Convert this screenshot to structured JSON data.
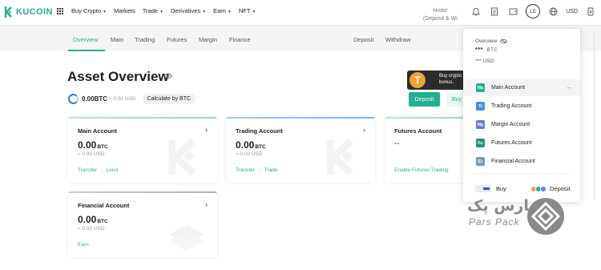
{
  "brand": {
    "name": "KUCOIN",
    "accent": "#23af91"
  },
  "topnav": {
    "items": [
      {
        "label": "Buy Crypto",
        "caret": true
      },
      {
        "label": "Markets",
        "caret": false
      },
      {
        "label": "Trade",
        "caret": true
      },
      {
        "label": "Derivatives",
        "caret": true
      },
      {
        "label": "Earn",
        "caret": true
      },
      {
        "label": "NFT",
        "caret": true
      }
    ],
    "right": {
      "icons": [
        "bell-icon",
        "orders-icon",
        "wallet-icon"
      ],
      "avatar": "LE",
      "currency": "USD"
    }
  },
  "subnav": {
    "tabs": [
      "Overview",
      "Main",
      "Trading",
      "Futures",
      "Margin",
      "Finance"
    ],
    "active": "Overview",
    "actions": [
      "Deposit",
      "Withdraw"
    ],
    "history": {
      "line1": "Histor",
      "line2": "(Deposit & Wi"
    }
  },
  "header": {
    "title": "Asset Overview",
    "balance": "0.00BTC",
    "balance_usd": "≈ 0.00 USD",
    "calc_button": "Calculate by BTC",
    "promo_line1": "Buy crypto",
    "promo_line2": "bonus.",
    "promo_coin": "T",
    "deposit_button": "Deposit",
    "buy_button": "Buy"
  },
  "cards": {
    "main": {
      "name": "Main Account",
      "amount": "0.00",
      "unit": "BTC",
      "approx": "≈ 0.00 USD",
      "links": [
        "Transfer",
        "Lend"
      ]
    },
    "trading": {
      "name": "Trading Account",
      "amount": "0.00",
      "unit": "BTC",
      "approx": "≈ 0.00 USD",
      "links": [
        "Transfer",
        "Trade"
      ]
    },
    "futures": {
      "name": "Futures Account",
      "value": "--",
      "link": "Enable Futures Trading"
    },
    "financial": {
      "name": "Financial Account",
      "amount": "0.00",
      "unit": "BTC",
      "approx": "≈ 0.00 USD",
      "link": "Earn"
    }
  },
  "dropdown": {
    "overview_label": "Overview",
    "btc_stars": "***",
    "btc_unit": "BTC",
    "usd_line": "*** USD",
    "items": [
      {
        "badge": "Ma",
        "label": "Main Account",
        "color": "#23af91"
      },
      {
        "badge": "Tr",
        "label": "Trading Account",
        "color": "#4a8de6"
      },
      {
        "badge": "Mg",
        "label": "Margin Account",
        "color": "#6d77d9"
      },
      {
        "badge": "Fu",
        "label": "Futures Account",
        "color": "#2f8f7c"
      },
      {
        "badge": "Er",
        "label": "Financial Account",
        "color": "#7c9ab3"
      }
    ],
    "buy_label": "Buy",
    "deposit_label": "Deposit"
  },
  "watermark": {
    "fa": "پارس پک",
    "en": "Pars Pack"
  }
}
